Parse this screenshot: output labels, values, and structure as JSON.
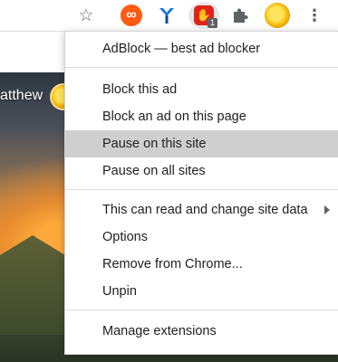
{
  "toolbar": {
    "star": "☆",
    "kebab": "⋮",
    "adblock_badge": "1"
  },
  "page": {
    "greeting": "atthew"
  },
  "menu": {
    "title": "AdBlock — best ad blocker",
    "items": [
      "Block this ad",
      "Block an ad on this page",
      "Pause on this site",
      "Pause on all sites"
    ],
    "permissions_label": "This can read and change site data",
    "options_label": "Options",
    "remove_label": "Remove from Chrome...",
    "unpin_label": "Unpin",
    "manage_label": "Manage extensions",
    "hovered_item": "Pause on this site"
  }
}
